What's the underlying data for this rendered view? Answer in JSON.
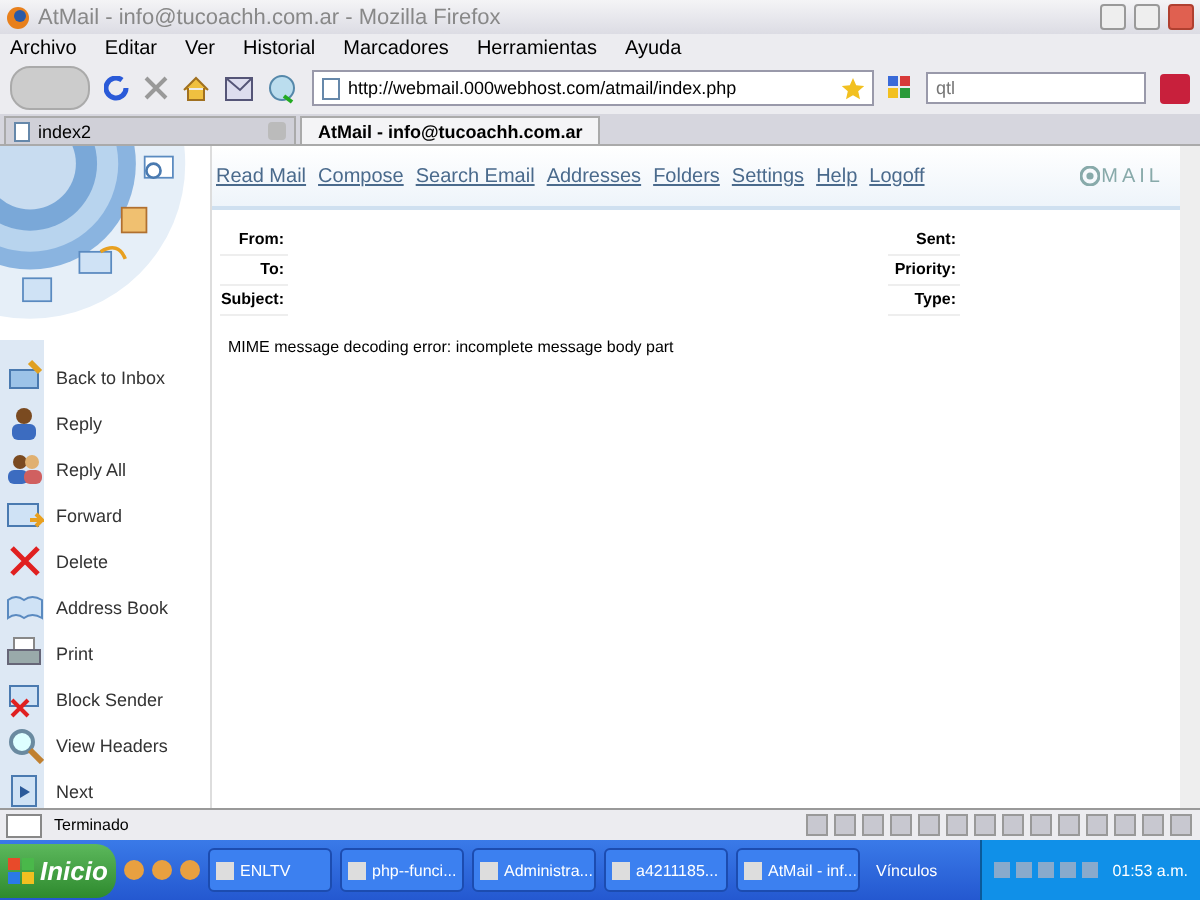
{
  "window": {
    "title": "AtMail - info@tucoachh.com.ar - Mozilla Firefox"
  },
  "menu": [
    "Archivo",
    "Editar",
    "Ver",
    "Historial",
    "Marcadores",
    "Herramientas",
    "Ayuda"
  ],
  "address_bar": {
    "value": "http://webmail.000webhost.com/atmail/index.php"
  },
  "search": {
    "placeholder": "qtl"
  },
  "tabs": [
    {
      "label": "index2",
      "selected": false
    },
    {
      "label": "AtMail - info@tucoachh.com.ar",
      "selected": true
    }
  ],
  "nav_links": [
    "Read Mail",
    "Compose",
    "Search Email",
    "Addresses",
    "Folders",
    "Settings",
    "Help",
    "Logoff"
  ],
  "logo": "MAIL",
  "header_left": [
    "From:",
    "To:",
    "Subject:"
  ],
  "header_right": [
    "Sent:",
    "Priority:",
    "Type:"
  ],
  "message": "MIME message decoding error: incomplete message body part",
  "actions": [
    "Back to Inbox",
    "Reply",
    "Reply All",
    "Forward",
    "Delete",
    "Address Book",
    "Print",
    "Block Sender",
    "View Headers",
    "Next"
  ],
  "status_bar": "Terminado",
  "taskbar": {
    "start": "Inicio",
    "tasks": [
      "ENLTV",
      "php--funci...",
      "Administra...",
      "a4211185...",
      "AtMail - inf..."
    ],
    "links": "Vínculos",
    "clock": "01:53 a.m."
  }
}
